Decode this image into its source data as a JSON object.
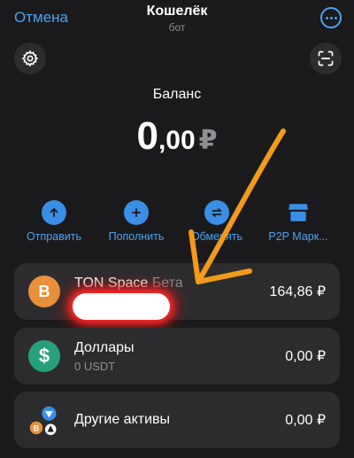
{
  "header": {
    "cancel_label": "Отмена",
    "title": "Кошелёк",
    "subtitle": "бот",
    "more_icon": "more-horizontal-icon"
  },
  "top_buttons": {
    "settings_icon": "gear-icon",
    "scan_icon": "qr-scan-icon"
  },
  "balance": {
    "label": "Баланс",
    "integer": "0",
    "decimal": ",00",
    "currency": "₽"
  },
  "actions": [
    {
      "label": "Отправить",
      "icon": "arrow-up-icon"
    },
    {
      "label": "Пополнить",
      "icon": "plus-icon"
    },
    {
      "label": "Обменять",
      "icon": "swap-icon"
    },
    {
      "label": "P2P Марк...",
      "icon": "store-icon"
    }
  ],
  "assets": [
    {
      "name": "TON Space",
      "tag": "Бета",
      "sub": "",
      "value": "164,86 ₽",
      "icon": "coin-b-icon",
      "icon_letter": "B",
      "icon_color": "#e8913a"
    },
    {
      "name": "Доллары",
      "sub": "0 USDT",
      "value": "0,00 ₽",
      "icon": "dollar-icon",
      "icon_letter": "$",
      "icon_color": "#26a17b"
    },
    {
      "name": "Другие активы",
      "sub": "",
      "value": "0,00 ₽",
      "icon": "multi-coin-icon",
      "icon_color": "#3a8ee6"
    }
  ],
  "colors": {
    "background": "#1a1a1c",
    "card": "#2c2c2e",
    "accent": "#4aa3f0",
    "arrow_annotation": "#f39a1a",
    "redaction_glow": "#ff2a2a"
  }
}
